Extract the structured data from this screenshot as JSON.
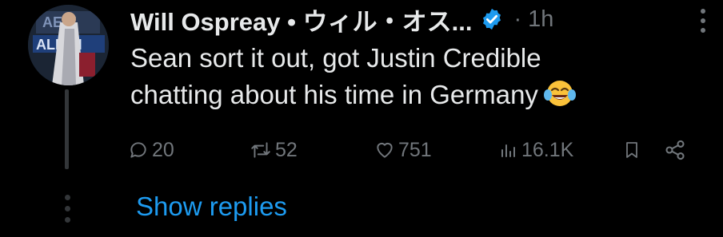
{
  "tweet": {
    "author_name": "Will Ospreay • ウィル・オス...",
    "separator": "·",
    "time": "1h",
    "text_line1": "Sean sort it out, got Justin Credible",
    "text_line2": "chatting about his time in Germany",
    "emoji": "face-with-tears-of-joy"
  },
  "avatar": {
    "image_text_top": "AEW",
    "image_text_mid": "ALL IN"
  },
  "actions": {
    "replies": "20",
    "reposts": "52",
    "likes": "751",
    "views": "16.1K"
  },
  "icons": {
    "verified": "verified-badge-icon",
    "more": "more-dots-icon",
    "reply": "reply-icon",
    "repost": "repost-icon",
    "like": "heart-icon",
    "views": "views-chart-icon",
    "bookmark": "bookmark-icon",
    "share": "share-icon"
  },
  "colors": {
    "background": "#000000",
    "text": "#e7e9ea",
    "muted": "#71767b",
    "accent": "#1d9bf0"
  },
  "show_replies_label": "Show replies"
}
